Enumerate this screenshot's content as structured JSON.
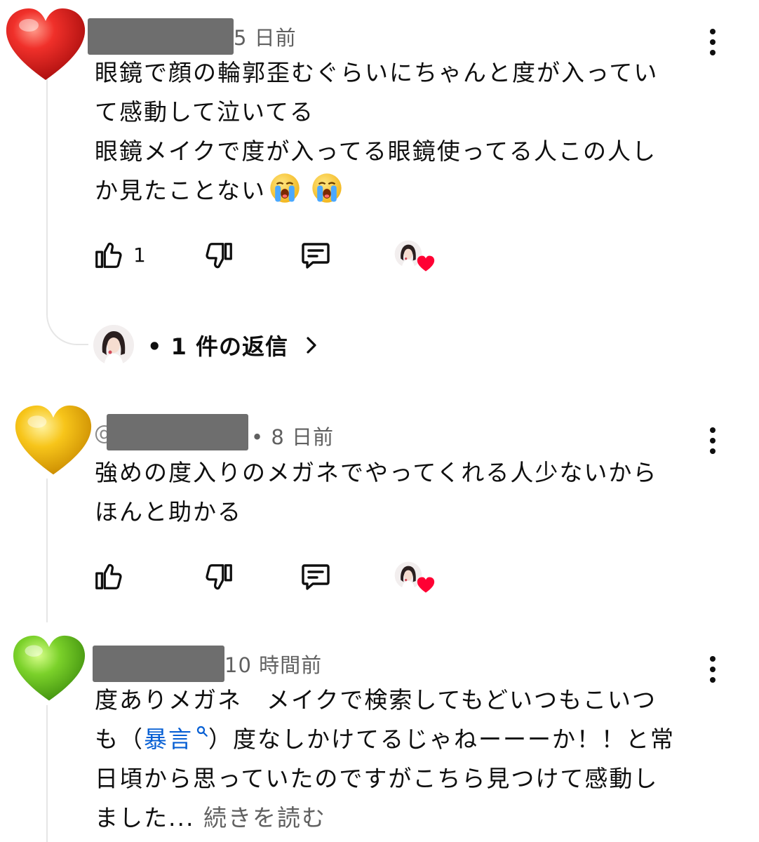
{
  "colors": {
    "link": "#065fd4",
    "muted": "#606060",
    "heart_red": "#ff0033"
  },
  "comments": [
    {
      "avatar": "red-heart",
      "handle_prefix": "",
      "time": "5 日前",
      "lines": [
        "眼鏡で顔の輪郭歪むぐらいにちゃんと度が入ってい",
        "て感動して泣いてる",
        "眼鏡メイクで度が入ってる眼鏡使ってる人この人し",
        "か見たことない"
      ],
      "emoji_count": 2,
      "like_count": "1",
      "replies_label": "• 1 件の返信"
    },
    {
      "avatar": "yellow-heart",
      "handle_prefix": "@",
      "time": "• 8 日前",
      "lines": [
        "強めの度入りのメガネでやってくれる人少ないから",
        "ほんと助かる"
      ]
    },
    {
      "avatar": "green-heart",
      "handle_prefix": "",
      "time": "10 時間前",
      "line1": "度ありメガネ　メイクで検索してもどいつもこいつ",
      "line2_pre": "も（",
      "line2_link": "暴言",
      "line2_post": "）度なしかけてるじゃねーーーか！！と常",
      "line3": "日頃から思っていたのですがこちら見つけて感動し",
      "line4": "ました...",
      "read_more": "続きを読む"
    }
  ]
}
